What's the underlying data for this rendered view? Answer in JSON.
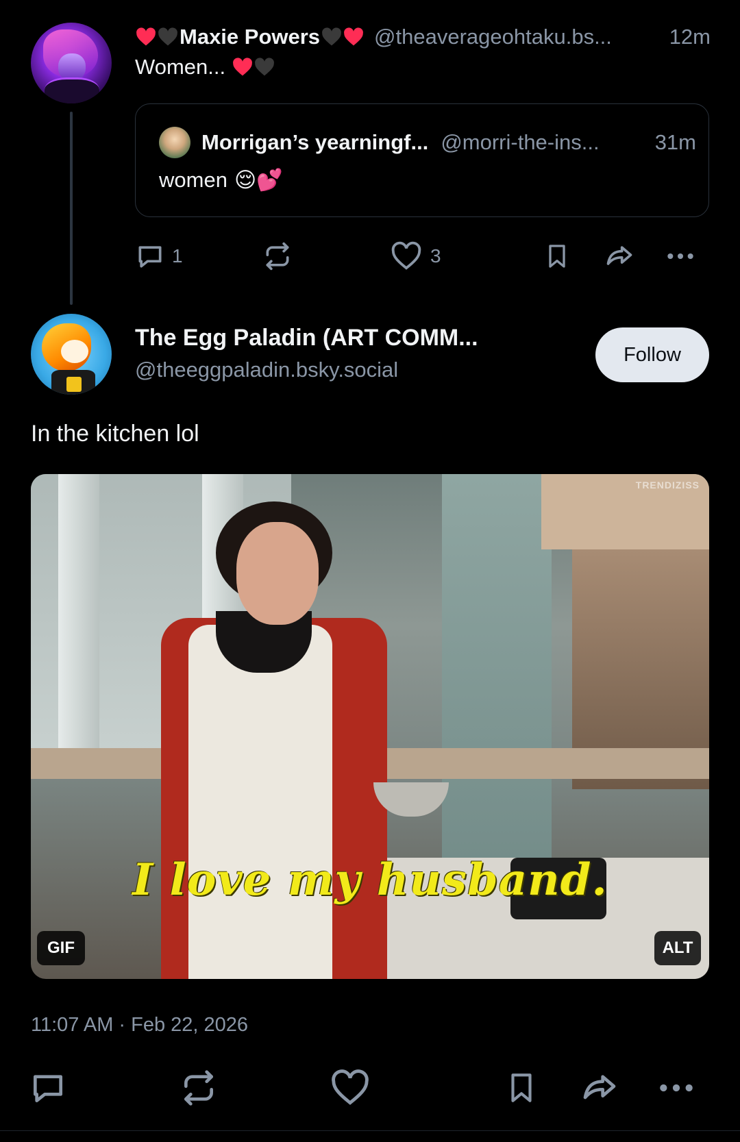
{
  "parent_post": {
    "display_name": "Maxie Powers",
    "handle": "@theaverageohtaku.bs...",
    "time": "12m",
    "text": "Women...",
    "quote": {
      "display_name": "Morrigan’s yearningf...",
      "handle": "@morri-the-ins...",
      "time": "31m",
      "text": "women",
      "emoji": "😌💕"
    },
    "actions": {
      "reply_count": "1",
      "like_count": "3"
    }
  },
  "main_post": {
    "display_name": "The Egg Paladin (ART COMM...",
    "handle": "@theeggpaladin.bsky.social",
    "follow_label": "Follow",
    "text": "In the kitchen lol",
    "media": {
      "caption": "I love my husband.",
      "watermark": "TRENDIZISS",
      "gif_badge": "GIF",
      "alt_badge": "ALT"
    },
    "timestamp": "11:07 AM · Feb 22, 2026"
  },
  "colors": {
    "background": "#000000",
    "text": "#f1f3f5",
    "muted": "#8a96a6",
    "heart_red": "#ff2d55",
    "heart_black": "#3a3a3a",
    "follow_bg": "#e3e8ef"
  }
}
